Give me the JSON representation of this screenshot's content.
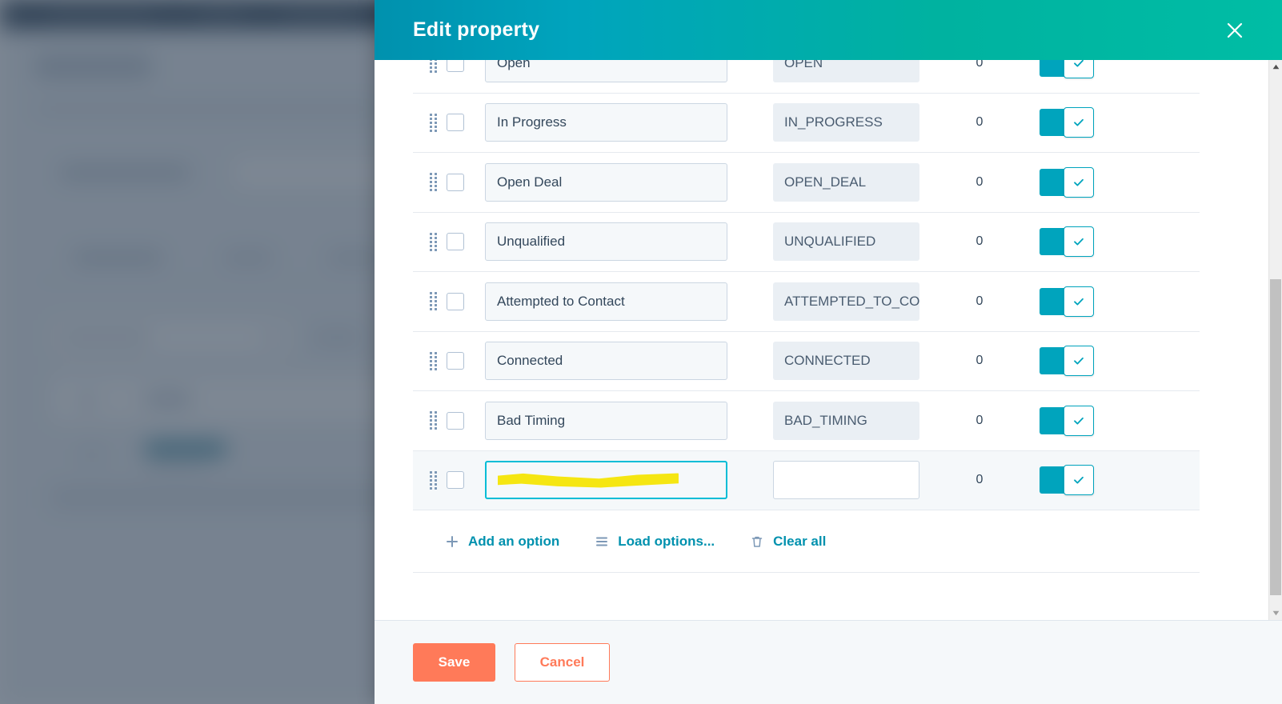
{
  "modal": {
    "title": "Edit property",
    "close_icon": "close-icon",
    "options": [
      {
        "label": "Open",
        "internal_value": "OPEN",
        "count": "0",
        "enabled": true,
        "selected": false,
        "focused": false
      },
      {
        "label": "In Progress",
        "internal_value": "IN_PROGRESS",
        "count": "0",
        "enabled": true,
        "selected": false,
        "focused": false
      },
      {
        "label": "Open Deal",
        "internal_value": "OPEN_DEAL",
        "count": "0",
        "enabled": true,
        "selected": false,
        "focused": false
      },
      {
        "label": "Unqualified",
        "internal_value": "UNQUALIFIED",
        "count": "0",
        "enabled": true,
        "selected": false,
        "focused": false
      },
      {
        "label": "Attempted to Contact",
        "internal_value": "ATTEMPTED_TO_CONTACT",
        "count": "0",
        "enabled": true,
        "selected": false,
        "focused": false
      },
      {
        "label": "Connected",
        "internal_value": "CONNECTED",
        "count": "0",
        "enabled": true,
        "selected": false,
        "focused": false
      },
      {
        "label": "Bad Timing",
        "internal_value": "BAD_TIMING",
        "count": "0",
        "enabled": true,
        "selected": false,
        "focused": false
      },
      {
        "label": "",
        "internal_value": "",
        "count": "0",
        "enabled": true,
        "selected": false,
        "focused": true
      }
    ],
    "list_actions": {
      "add_option": "Add an option",
      "load_options": "Load options...",
      "clear_all": "Clear all"
    },
    "footer": {
      "save": "Save",
      "cancel": "Cancel"
    }
  },
  "colors": {
    "header_gradient_start": "#0091ae",
    "header_gradient_end": "#00bda5",
    "toggle_on": "#00a4bd",
    "link": "#0091ae",
    "primary_button": "#ff7a59",
    "highlight_mark": "#f5e612"
  },
  "scrollbar": {
    "up_arrow_icon": "caret-up-icon",
    "down_arrow_icon": "caret-down-icon"
  }
}
